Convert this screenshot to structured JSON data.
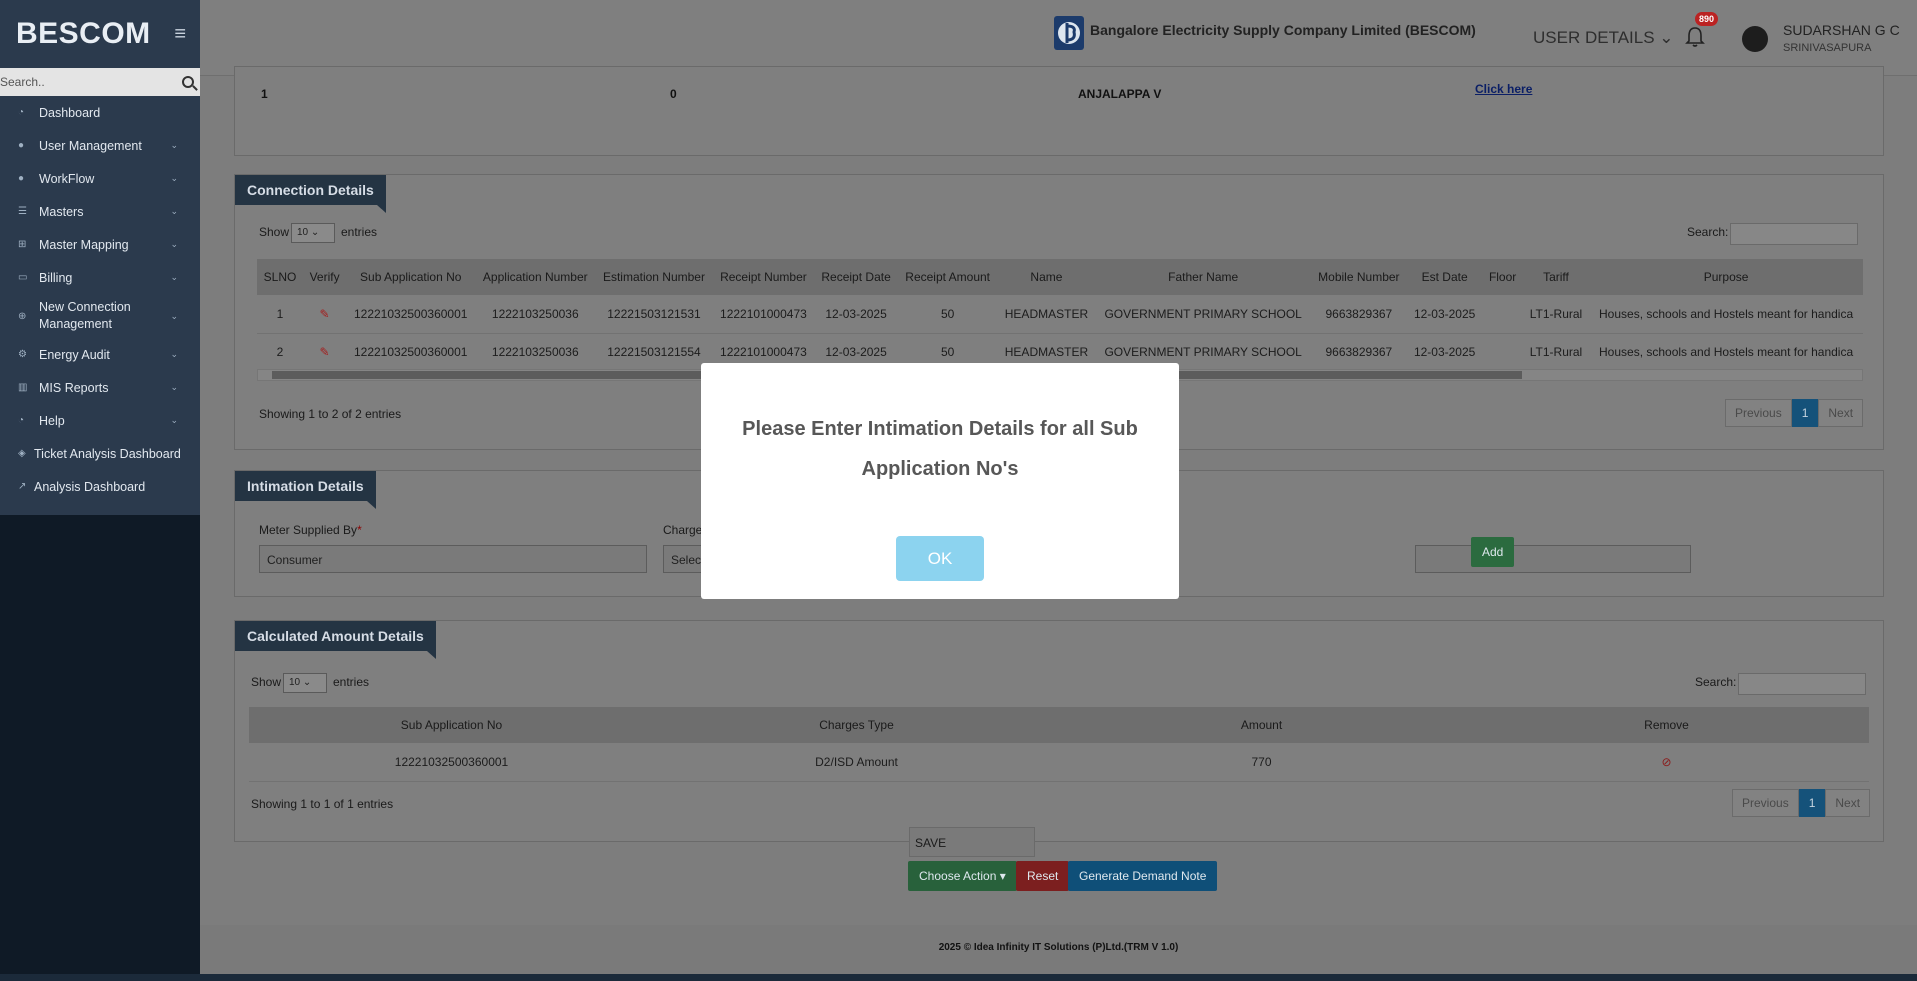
{
  "brand": {
    "name": "BESCOM"
  },
  "sidebar": {
    "search_placeholder": "Search..",
    "items": [
      {
        "label": "Dashboard"
      },
      {
        "label": "User Management"
      },
      {
        "label": "WorkFlow"
      },
      {
        "label": "Masters"
      },
      {
        "label": "Master Mapping"
      },
      {
        "label": "Billing"
      },
      {
        "label": "New Connection Management"
      },
      {
        "label": "Energy Audit"
      },
      {
        "label": "MIS Reports"
      },
      {
        "label": "Help"
      },
      {
        "label": "Ticket Analysis Dashboard"
      },
      {
        "label": "Analysis Dashboard"
      }
    ]
  },
  "header": {
    "company": "Bangalore Electricity Supply Company Limited (BESCOM)",
    "user_details": "USER DETAILS",
    "notifications": "890",
    "user_name": "SUDARSHAN G C",
    "user_location": "SRINIVASAPURA"
  },
  "top_row": {
    "c1": "1",
    "c2": "0",
    "c3": "ANJALAPPA V",
    "link": "Click here"
  },
  "connection": {
    "title": "Connection Details",
    "show": "Show",
    "entries_value": "10",
    "entries": "entries",
    "search_label": "Search:",
    "columns": [
      "SLNO",
      "Verify",
      "Sub Application No",
      "Application Number",
      "Estimation Number",
      "Receipt Number",
      "Receipt Date",
      "Receipt Amount",
      "Name",
      "Father Name",
      "Mobile Number",
      "Est Date",
      "Floor",
      "Tariff",
      "Purpose"
    ],
    "rows": [
      [
        "1",
        "",
        "12221032500360001",
        "1222103250036",
        "12221503121531",
        "1222101000473",
        "12-03-2025",
        "50",
        "HEADMASTER",
        "GOVERNMENT PRIMARY SCHOOL",
        "9663829367",
        "12-03-2025",
        "",
        "LT1-Rural",
        "Houses, schools and Hostels meant for handica"
      ],
      [
        "2",
        "",
        "12221032500360001",
        "1222103250036",
        "12221503121554",
        "1222101000473",
        "12-03-2025",
        "50",
        "HEADMASTER",
        "GOVERNMENT PRIMARY SCHOOL",
        "9663829367",
        "12-03-2025",
        "",
        "LT1-Rural",
        "Houses, schools and Hostels meant for handica"
      ]
    ],
    "info": "Showing 1 to 2 of 2 entries",
    "prev": "Previous",
    "page": "1",
    "next": "Next"
  },
  "intimation": {
    "title": "Intimation Details",
    "meter_label": "Meter Supplied By",
    "required": "*",
    "meter_value": "Consumer",
    "charge_label": "Charge",
    "charge_value": "Select",
    "add": "Add"
  },
  "calculated": {
    "title": "Calculated Amount Details",
    "show": "Show",
    "entries_value": "10",
    "entries": "entries",
    "search_label": "Search:",
    "columns": [
      "Sub Application No",
      "Charges Type",
      "Amount",
      "Remove"
    ],
    "rows": [
      [
        "12221032500360001",
        "D2/ISD Amount",
        "770",
        ""
      ]
    ],
    "info": "Showing 1 to 1 of 1 entries",
    "prev": "Previous",
    "page": "1",
    "next": "Next"
  },
  "actions": {
    "dropdown_item": "SAVE",
    "choose": "Choose Action",
    "reset": "Reset",
    "generate": "Generate Demand Note"
  },
  "footer": {
    "text": "2025 © Idea Infinity IT Solutions (P)Ltd.(TRM V 1.0)"
  },
  "modal": {
    "message": "Please Enter Intimation Details for all Sub Application No's",
    "ok": "OK"
  }
}
